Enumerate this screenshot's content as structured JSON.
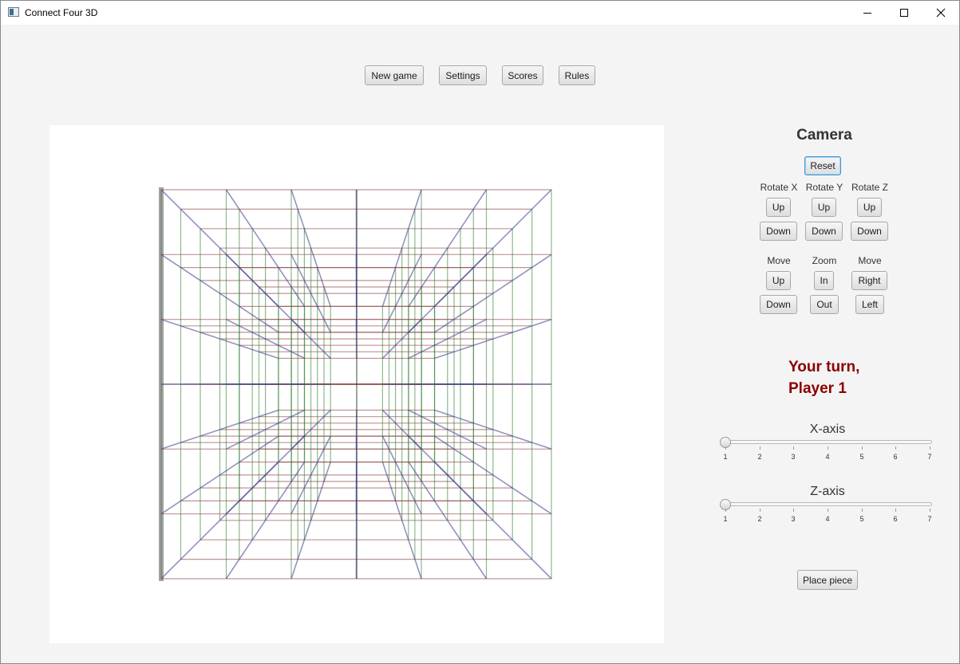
{
  "window": {
    "title": "Connect Four 3D"
  },
  "toolbar": {
    "new_game": "New game",
    "settings": "Settings",
    "scores": "Scores",
    "rules": "Rules"
  },
  "camera": {
    "title": "Camera",
    "reset": "Reset",
    "rotate_x": "Rotate X",
    "rotate_y": "Rotate Y",
    "rotate_z": "Rotate Z",
    "up": "Up",
    "down": "Down",
    "move": "Move",
    "zoom": "Zoom",
    "zoom_in": "In",
    "zoom_out": "Out",
    "right": "Right",
    "left": "Left"
  },
  "status": {
    "line1": "Your turn,",
    "line2": "Player 1"
  },
  "sliders": {
    "x_axis": {
      "label": "X-axis",
      "value": 1,
      "min": 1,
      "max": 7,
      "ticks": [
        "1",
        "2",
        "3",
        "4",
        "5",
        "6",
        "7"
      ]
    },
    "z_axis": {
      "label": "Z-axis",
      "value": 1,
      "min": 1,
      "max": 7,
      "ticks": [
        "1",
        "2",
        "3",
        "4",
        "5",
        "6",
        "7"
      ]
    }
  },
  "actions": {
    "place_piece": "Place piece"
  },
  "colors": {
    "turn_text": "#8b0000",
    "grid_red": "#8b3a3a",
    "grid_green": "#2e7d2e",
    "grid_blue": "#3a3a8b",
    "focus_border": "#3c9ad4"
  }
}
